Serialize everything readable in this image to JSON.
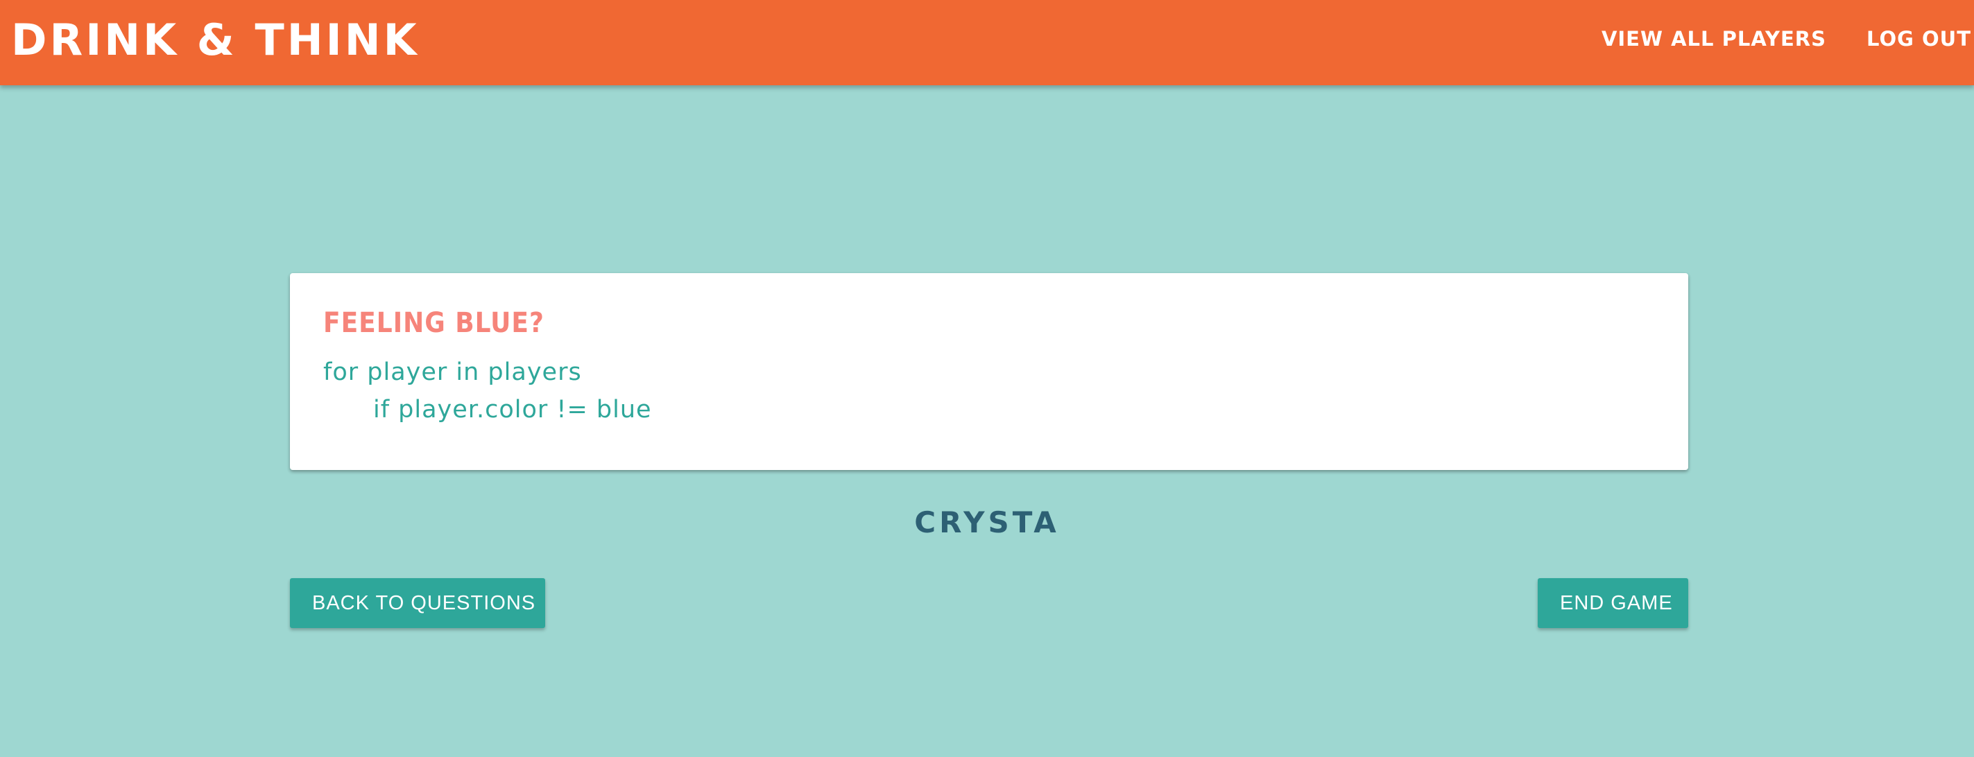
{
  "header": {
    "brand": "DRINK & THINK",
    "nav": {
      "view_all_players": "VIEW ALL PLAYERS",
      "log_out": "LOG OUT"
    },
    "color": "#f06833"
  },
  "question_card": {
    "title": "FEELING BLUE?",
    "code_lines": [
      "for player in players",
      "if player.color != blue"
    ]
  },
  "player": {
    "name": "CRYSTA"
  },
  "actions": {
    "back_label": "BACK TO QUESTIONS",
    "end_label": "END GAME"
  },
  "colors": {
    "background": "#9ed7d1",
    "accent": "#2ea79a",
    "title": "#f6847a",
    "player_name": "#2d6074"
  }
}
